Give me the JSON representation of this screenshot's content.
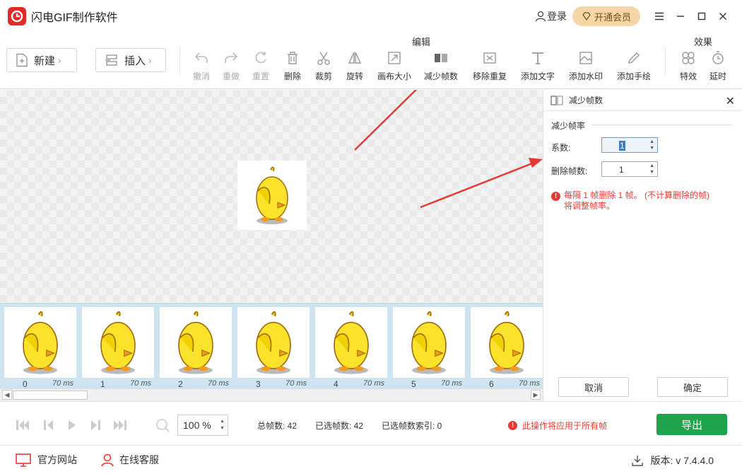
{
  "app": {
    "title": "闪电GIF制作软件",
    "login": "登录",
    "vip": "开通会员",
    "accent": "#e02b2b",
    "export_color": "#1ea54c",
    "warn_color": "#e53935"
  },
  "toolbar": {
    "new": "新建",
    "insert": "插入",
    "group_edit": "编辑",
    "group_effects": "效果",
    "tools": [
      {
        "label": "撤消",
        "icon": "undo-icon",
        "enabled": false
      },
      {
        "label": "重做",
        "icon": "redo-icon",
        "enabled": false
      },
      {
        "label": "重置",
        "icon": "reset-icon",
        "enabled": false
      },
      {
        "label": "删除",
        "icon": "trash-icon",
        "enabled": true
      },
      {
        "label": "裁剪",
        "icon": "scissors-icon",
        "enabled": true
      },
      {
        "label": "旋转",
        "icon": "rotate-icon",
        "enabled": true
      },
      {
        "label": "画布大小",
        "icon": "canvas-size-icon",
        "enabled": true
      },
      {
        "label": "减少帧数",
        "icon": "reduce-frames-icon",
        "enabled": true
      },
      {
        "label": "移除重复",
        "icon": "remove-duplicate-icon",
        "enabled": true
      },
      {
        "label": "添加文字",
        "icon": "text-icon",
        "enabled": true
      },
      {
        "label": "添加水印",
        "icon": "watermark-icon",
        "enabled": true
      },
      {
        "label": "添加手绘",
        "icon": "pencil-icon",
        "enabled": true
      },
      {
        "label": "特效",
        "icon": "effects-icon",
        "enabled": true
      },
      {
        "label": "延时",
        "icon": "timer-icon",
        "enabled": true
      }
    ]
  },
  "frames": [
    {
      "index": "0",
      "ms": "70 ms"
    },
    {
      "index": "1",
      "ms": "70 ms"
    },
    {
      "index": "2",
      "ms": "70 ms"
    },
    {
      "index": "3",
      "ms": "70 ms"
    },
    {
      "index": "4",
      "ms": "70 ms"
    },
    {
      "index": "5",
      "ms": "70 ms"
    },
    {
      "index": "6",
      "ms": "70 ms"
    }
  ],
  "panel": {
    "title": "减少帧数",
    "section": "减少帧率",
    "factor_label": "系数:",
    "factor_value": "1",
    "delete_label": "删除帧数:",
    "delete_value": "1",
    "info_line1": "每隔 1 帧删除 1 帧。 (不计算删除的帧)",
    "info_line2": "将调整帧率。",
    "cancel": "取消",
    "confirm": "确定"
  },
  "controls": {
    "zoom": "100",
    "zoom_unit": "%",
    "total_frames": "总帧数: 42",
    "selected_frames": "已选帧数: 42",
    "selected_index": "已选帧数索引: 0",
    "warning": "此操作将应用于所有帧",
    "export": "导出"
  },
  "footer": {
    "website": "官方网站",
    "support": "在线客服",
    "version": "版本: v 7.4.4.0"
  }
}
